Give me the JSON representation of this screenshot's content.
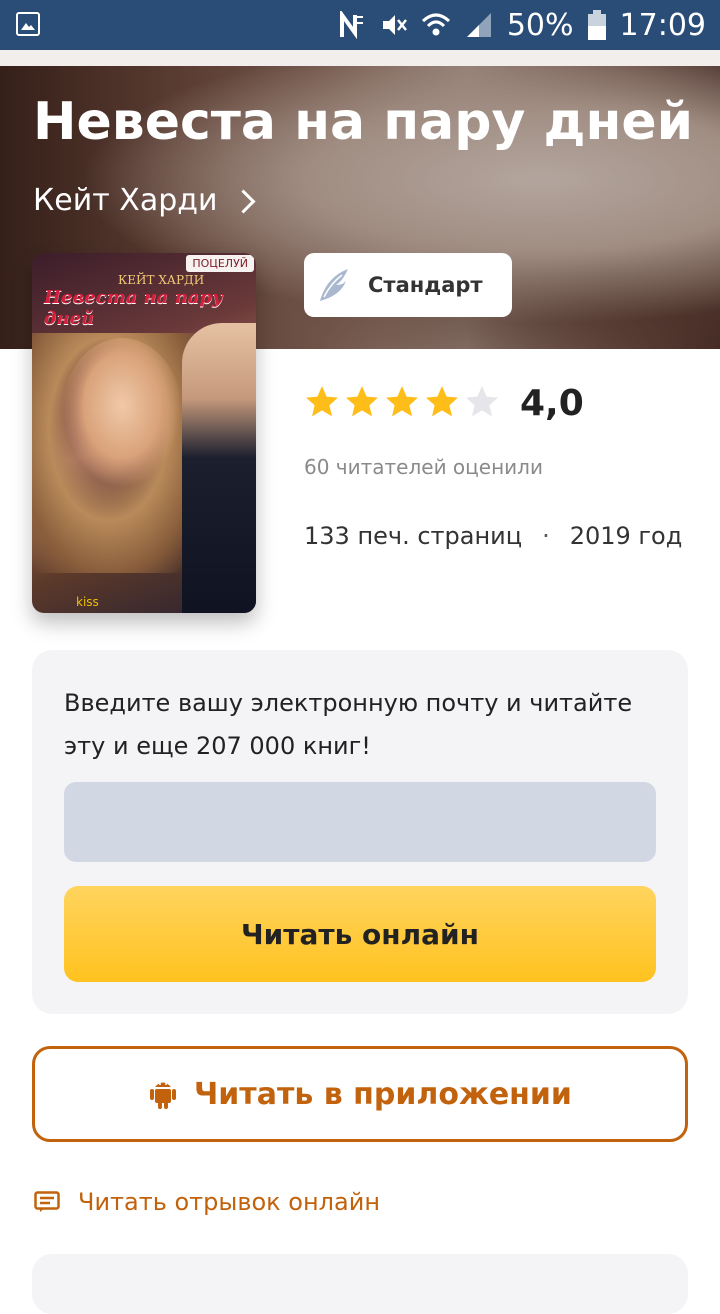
{
  "status_bar": {
    "battery_percent": "50%",
    "time": "17:09"
  },
  "book": {
    "title": "Невеста на пару дней",
    "author": "Кейт Харди",
    "cover": {
      "author": "КЕЙТ ХАРДИ",
      "title": "Невеста на пару дней",
      "series_badge": "ПОЦЕЛУЙ",
      "imprint": "kiss"
    },
    "subscription": "Стандарт",
    "rating": "4,0",
    "rating_stars": 4,
    "max_stars": 5,
    "raters": "60 читателей оценили",
    "pages": "133 печ. страниц",
    "separator": "·",
    "year": "2019 год"
  },
  "signup": {
    "prompt": "Введите вашу электронную почту и читайте эту и еще 207 000 книг!",
    "email_placeholder": "",
    "read_online_label": "Читать онлайн"
  },
  "app_button": {
    "label": "Читать в приложении"
  },
  "excerpt_link": {
    "label": "Читать отрывок онлайн"
  },
  "colors": {
    "accent": "#c2620c",
    "star": "#ffbd1a",
    "button_yellow": "#ffc21f",
    "status_bar": "#2a4d77"
  }
}
